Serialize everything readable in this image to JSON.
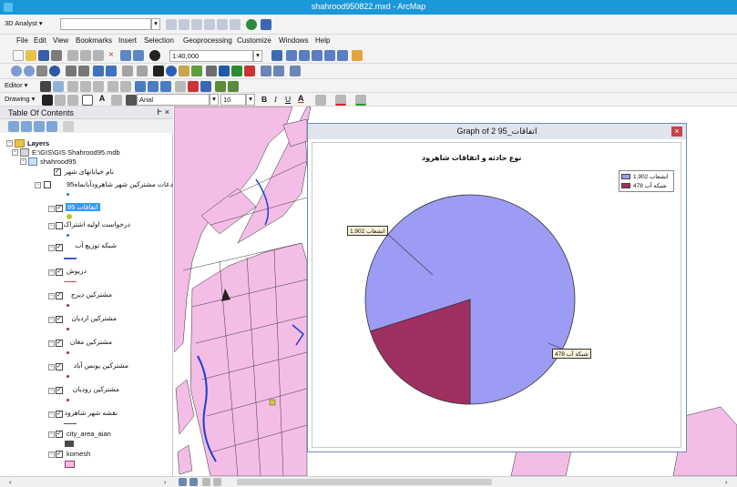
{
  "window": {
    "title": "shahrood950822.mxd - ArcMap"
  },
  "toolbar": {
    "analyst_label": "3D Analyst ▾",
    "scale": "1:40,000",
    "editor_label": "Editor ▾",
    "drawing_label": "Drawing ▾",
    "font_name": "Arial",
    "font_size": "10",
    "bold": "B",
    "italic": "I",
    "underline": "U",
    "font_color": "A"
  },
  "menu": {
    "items": [
      {
        "label": "File"
      },
      {
        "label": "Edit"
      },
      {
        "label": "View"
      },
      {
        "label": "Bookmarks"
      },
      {
        "label": "Insert"
      },
      {
        "label": "Selection"
      },
      {
        "label": "Geoprocessing"
      },
      {
        "label": "Customize"
      },
      {
        "label": "Windows"
      },
      {
        "label": "Help"
      }
    ]
  },
  "toc": {
    "title": "Table Of Contents",
    "pin": "Ͱ ×",
    "root": "Layers",
    "database": "E:\\GIS\\GIS Shahrood95.mdb",
    "group": "shahrood95",
    "layers": [
      {
        "label": "نام خیابانهای شهر",
        "checked": "✓"
      },
      {
        "label": "دعات مشترکین شهر شاهرودآبانماه95",
        "checked": ""
      },
      {
        "label": "اتفاقات 95",
        "checked": "✓"
      },
      {
        "label": "درخواست اولیه اشتراک",
        "checked": ""
      },
      {
        "label": "شبکه توزیع آب",
        "checked": "✓"
      },
      {
        "label": "دریوش",
        "checked": "✓"
      },
      {
        "label": "مشترکین دیرج",
        "checked": "✓"
      },
      {
        "label": "مشترکین اردیان",
        "checked": "✓"
      },
      {
        "label": "مشترکین مغان",
        "checked": "✓"
      },
      {
        "label": "مشترکین یونس آباد",
        "checked": "✓"
      },
      {
        "label": "مشترکین رودیان",
        "checked": "✓"
      },
      {
        "label": "نقشه شهر شاهرود",
        "checked": "✓"
      },
      {
        "label": "city_area_aian",
        "checked": "✓"
      },
      {
        "label": "komesh",
        "checked": "✓"
      }
    ]
  },
  "graph": {
    "window_title": "Graph of اتفاقات_95 2",
    "close": "×",
    "callout_large": "انشعاب 1,902",
    "callout_small": "شبکه آب 478"
  },
  "chart_data": {
    "type": "pie",
    "title": "نوع حادثه و اتفاقات شاهرود",
    "categories": [
      "انشعاب",
      "شبکه آب"
    ],
    "values": [
      1902,
      478
    ],
    "legend_labels": [
      "انشعاب 1,902",
      "شبکه آب 478"
    ],
    "colors": [
      "#9c9cf4",
      "#9e2f61"
    ],
    "legend": "top-right"
  },
  "colors": {
    "title_bar": "#1a98d8",
    "parcel_fill": "#f3bde6",
    "selection": "#3399ff"
  }
}
